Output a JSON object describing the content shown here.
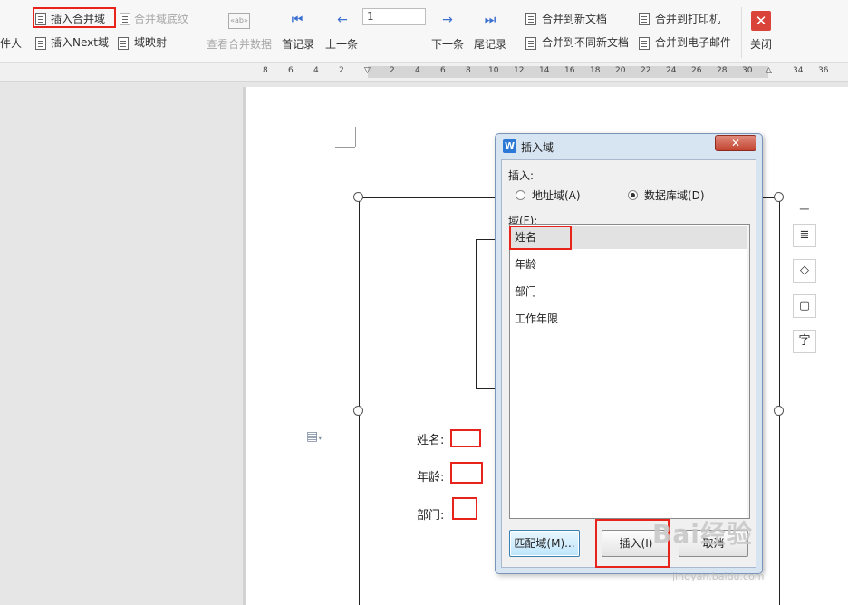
{
  "ribbon": {
    "cut_left_label": "件人",
    "insert_merge_field": "插入合并域",
    "merge_field_shading": "合并域底纹",
    "insert_next_field": "插入Next域",
    "field_mapping": "域映射",
    "view_merged_data": "查看合并数据",
    "first_record": "首记录",
    "prev_record": "上一条",
    "record_number": "1",
    "next_record": "下一条",
    "last_record": "尾记录",
    "merge_new_doc": "合并到新文档",
    "merge_diff_docs": "合并到不同新文档",
    "merge_printer": "合并到打印机",
    "merge_email": "合并到电子邮件",
    "close": "关闭",
    "ab_icon_text": "«ab»"
  },
  "ruler": {
    "ticks": [
      "8",
      "6",
      "4",
      "2",
      "2",
      "4",
      "6",
      "8",
      "10",
      "12",
      "14",
      "16",
      "18",
      "20",
      "22",
      "24",
      "26",
      "28",
      "30",
      "34",
      "36"
    ]
  },
  "document": {
    "fields": [
      {
        "label": "姓名:"
      },
      {
        "label": "年龄:"
      },
      {
        "label": "部门:"
      }
    ]
  },
  "side_tools": [
    "−",
    "≣",
    "◇",
    "▢",
    "字"
  ],
  "dialog": {
    "title": "插入域",
    "insert_label": "插入:",
    "radio_address": "地址域(A)",
    "radio_database": "数据库域(D)",
    "field_label": "域(F):",
    "fields": [
      "姓名",
      "年龄",
      "部门",
      "工作年限"
    ],
    "selected_index": 0,
    "btn_match": "匹配域(M)...",
    "btn_insert": "插入(I)",
    "btn_cancel": "取消",
    "close_glyph": "✕"
  },
  "watermark": {
    "text": "Bai经验",
    "url": "jingyan.baidu.com"
  },
  "colors": {
    "highlight": "#e8231c",
    "close_button": "#d9433a",
    "dialog_frame": "#d7e4f2"
  }
}
